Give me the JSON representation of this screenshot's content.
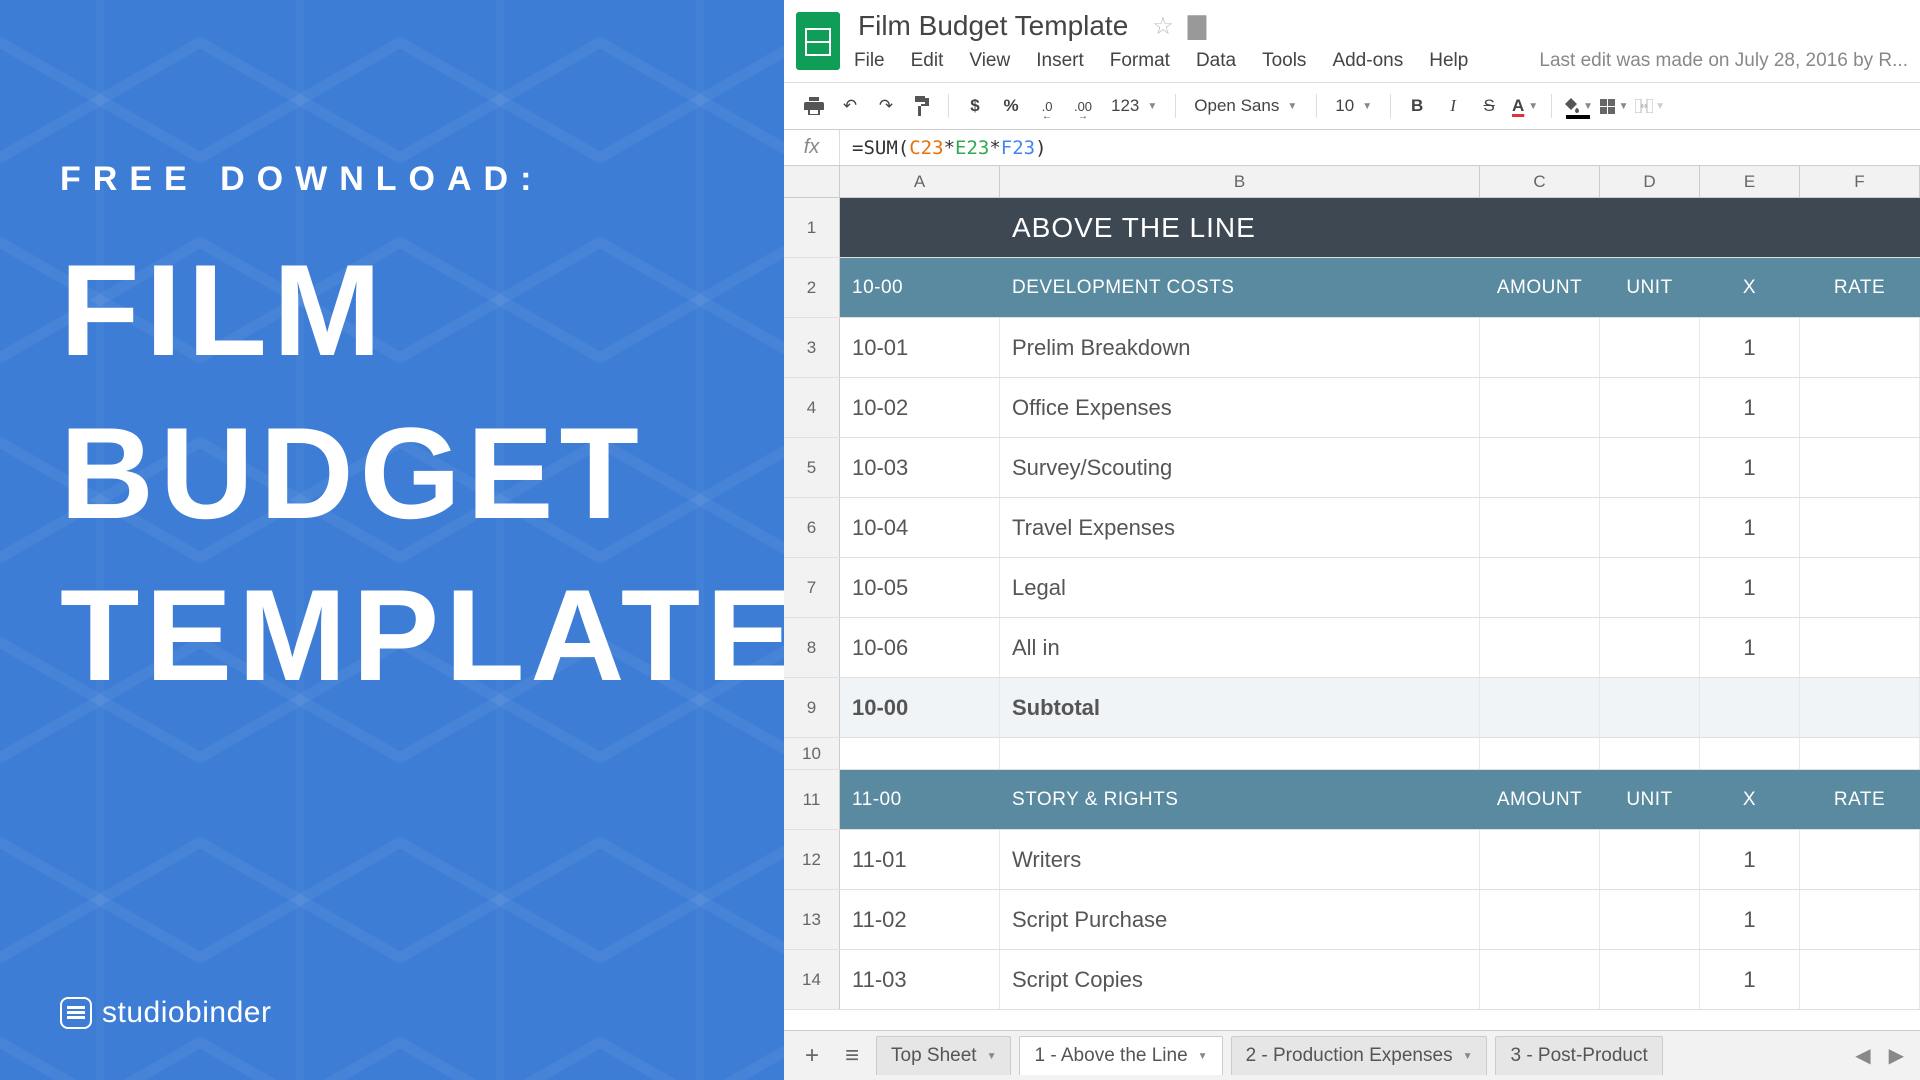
{
  "promo": {
    "subtitle": "FREE DOWNLOAD:",
    "title_l1": "FILM",
    "title_l2": "BUDGET",
    "title_l3": "TEMPLATE",
    "logo_text": "studiobinder"
  },
  "doc": {
    "title": "Film Budget Template",
    "last_edit": "Last edit was made on July 28, 2016 by R..."
  },
  "menu": {
    "file": "File",
    "edit": "Edit",
    "view": "View",
    "insert": "Insert",
    "format": "Format",
    "data": "Data",
    "tools": "Tools",
    "addons": "Add-ons",
    "help": "Help"
  },
  "toolbar": {
    "dollar": "$",
    "percent": "%",
    "dec_dec": ".0",
    "dec_inc": ".00",
    "fmt_123": "123",
    "font": "Open Sans",
    "font_size": "10",
    "bold": "B",
    "italic": "I",
    "strike": "S",
    "text_color": "A"
  },
  "formula": {
    "fx": "fx",
    "eq": "=",
    "fn": "SUM",
    "open": "(",
    "r1": "C23",
    "m1": "*",
    "r2": "E23",
    "m2": "*",
    "r3": "F23",
    "close": ")"
  },
  "columns": {
    "A": "A",
    "B": "B",
    "C": "C",
    "D": "D",
    "E": "E",
    "F": "F"
  },
  "rows": [
    {
      "n": "1",
      "type": "section",
      "A": "",
      "B": "ABOVE THE LINE",
      "C": "",
      "D": "",
      "E": "",
      "F": ""
    },
    {
      "n": "2",
      "type": "header",
      "A": "10-00",
      "B": "DEVELOPMENT COSTS",
      "C": "AMOUNT",
      "D": "UNIT",
      "E": "X",
      "F": "RATE"
    },
    {
      "n": "3",
      "type": "data",
      "A": "10-01",
      "B": "Prelim Breakdown",
      "C": "",
      "D": "",
      "E": "1",
      "F": ""
    },
    {
      "n": "4",
      "type": "data",
      "A": "10-02",
      "B": "Office Expenses",
      "C": "",
      "D": "",
      "E": "1",
      "F": ""
    },
    {
      "n": "5",
      "type": "data",
      "A": "10-03",
      "B": "Survey/Scouting",
      "C": "",
      "D": "",
      "E": "1",
      "F": ""
    },
    {
      "n": "6",
      "type": "data",
      "A": "10-04",
      "B": "Travel Expenses",
      "C": "",
      "D": "",
      "E": "1",
      "F": ""
    },
    {
      "n": "7",
      "type": "data",
      "A": "10-05",
      "B": "Legal",
      "C": "",
      "D": "",
      "E": "1",
      "F": ""
    },
    {
      "n": "8",
      "type": "data",
      "A": "10-06",
      "B": "All in",
      "C": "",
      "D": "",
      "E": "1",
      "F": ""
    },
    {
      "n": "9",
      "type": "subtotal",
      "A": "10-00",
      "B": "Subtotal",
      "C": "",
      "D": "",
      "E": "",
      "F": ""
    },
    {
      "n": "10",
      "type": "blank-short",
      "A": "",
      "B": "",
      "C": "",
      "D": "",
      "E": "",
      "F": ""
    },
    {
      "n": "11",
      "type": "header",
      "A": "11-00",
      "B": "STORY & RIGHTS",
      "C": "AMOUNT",
      "D": "UNIT",
      "E": "X",
      "F": "RATE"
    },
    {
      "n": "12",
      "type": "data",
      "A": "11-01",
      "B": "Writers",
      "C": "",
      "D": "",
      "E": "1",
      "F": ""
    },
    {
      "n": "13",
      "type": "data",
      "A": "11-02",
      "B": "Script Purchase",
      "C": "",
      "D": "",
      "E": "1",
      "F": ""
    },
    {
      "n": "14",
      "type": "data",
      "A": "11-03",
      "B": "Script Copies",
      "C": "",
      "D": "",
      "E": "1",
      "F": ""
    }
  ],
  "tabs": {
    "add": "+",
    "list": "≡",
    "t0": "Top Sheet",
    "t1": "1 - Above the Line",
    "t2": "2 - Production Expenses",
    "t3": "3 - Post-Product"
  }
}
